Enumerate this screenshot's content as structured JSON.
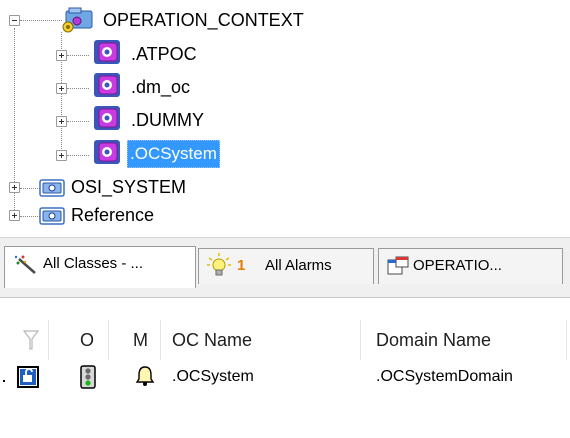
{
  "tree": {
    "root": {
      "label": "OPERATION_CONTEXT",
      "icon": "operation-context-folder-icon"
    },
    "children": [
      {
        "label": ".ATPOC",
        "icon": "purple-cube-icon",
        "selected": false
      },
      {
        "label": ".dm_oc",
        "icon": "purple-cube-icon",
        "selected": false
      },
      {
        "label": ".DUMMY",
        "icon": "purple-cube-icon",
        "selected": false
      },
      {
        "label": ".OCSystem",
        "icon": "purple-cube-icon",
        "selected": true
      }
    ],
    "siblings": [
      {
        "label": "OSI_SYSTEM",
        "icon": "database-icon"
      },
      {
        "label": "Reference",
        "icon": "database-icon"
      }
    ]
  },
  "tabs": [
    {
      "label": "All Classes - ...",
      "icon": "magic-wand-icon",
      "active": true
    },
    {
      "count": "1",
      "label": "All Alarms",
      "icon": "lightbulb-icon",
      "active": false
    },
    {
      "label": "OPERATIO...",
      "icon": "window-properties-icon",
      "active": false
    }
  ],
  "grid": {
    "headers": [
      "O",
      "M",
      "OC Name",
      "Domain Name"
    ],
    "rows": [
      {
        "oc_name": ".OCSystem",
        "domain_name": ".OCSystemDomain"
      }
    ]
  },
  "colors": {
    "selection": "#3399ff",
    "alarm_count": "#e87a00",
    "cube_purple": "#c93be0",
    "cube_blue": "#3a56b8"
  }
}
